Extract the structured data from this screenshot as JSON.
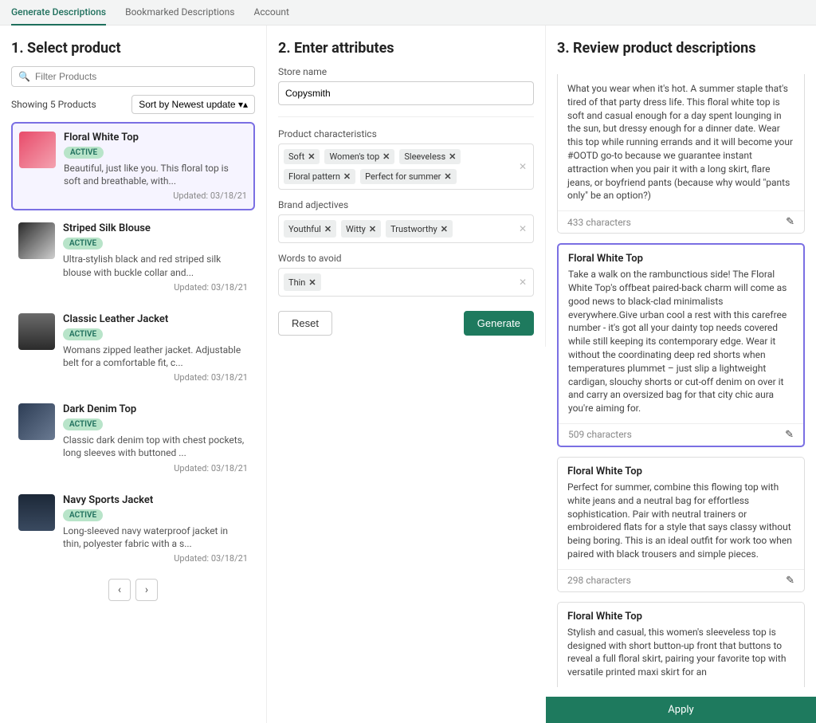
{
  "nav": {
    "tabs": [
      "Generate Descriptions",
      "Bookmarked Descriptions",
      "Account"
    ],
    "active": 0
  },
  "col1": {
    "title": "1. Select product",
    "filter_placeholder": "Filter Products",
    "showing": "Showing 5 Products",
    "sort_label": "Sort by Newest update",
    "updated_prefix": "Updated: ",
    "products": [
      {
        "name": "Floral White Top",
        "status": "ACTIVE",
        "desc": "Beautiful, just like you. This floral top is soft and breathable, with...",
        "updated": "03/18/21",
        "thumb": "th-floral",
        "selected": true
      },
      {
        "name": "Striped Silk Blouse",
        "status": "ACTIVE",
        "desc": "Ultra-stylish black and red striped silk blouse with buckle collar and...",
        "updated": "03/18/21",
        "thumb": "th-striped"
      },
      {
        "name": "Classic Leather Jacket",
        "status": "ACTIVE",
        "desc": "Womans zipped leather jacket. Adjustable belt for a comfortable fit, c...",
        "updated": "03/18/21",
        "thumb": "th-leather"
      },
      {
        "name": "Dark Denim Top",
        "status": "ACTIVE",
        "desc": "Classic dark denim top with chest pockets, long sleeves with buttoned ...",
        "updated": "03/18/21",
        "thumb": "th-denim"
      },
      {
        "name": "Navy Sports Jacket",
        "status": "ACTIVE",
        "desc": "Long-sleeved navy waterproof jacket in thin, polyester fabric with a s...",
        "updated": "03/18/21",
        "thumb": "th-navy"
      }
    ]
  },
  "col2": {
    "title": "2. Enter attributes",
    "store_label": "Store name",
    "store_value": "Copysmith",
    "pc_label": "Product characteristics",
    "pc_tags": [
      "Soft",
      "Women's top",
      "Sleeveless",
      "Floral pattern",
      "Perfect for summer"
    ],
    "ba_label": "Brand adjectives",
    "ba_tags": [
      "Youthful",
      "Witty",
      "Trustworthy"
    ],
    "wa_label": "Words to avoid",
    "wa_tags": [
      "Thin"
    ],
    "reset": "Reset",
    "generate": "Generate"
  },
  "col3": {
    "title": "3. Review product descriptions",
    "apply": "Apply",
    "cards": [
      {
        "title": "",
        "text": "What you wear when it's hot. A summer staple that's tired of that party dress life. This floral white top is soft and casual enough for a day spent lounging in the sun, but dressy enough for a dinner date. Wear this top while running errands and it will become your #OOTD go-to because we guarantee instant attraction when you pair it with a long skirt, flare jeans, or boyfriend pants (because why would \"pants only\" be an option?)",
        "chars": "433 characters",
        "top_cut": true
      },
      {
        "title": "Floral White Top",
        "text": "Take a walk on the rambunctious side! The Floral White Top's offbeat paired-back charm will come as good news to black-clad minimalists everywhere.Give urban cool a rest with this carefree number - it's got all your dainty top needs covered while still keeping its contemporary edge. Wear it without the coordinating deep red shorts when temperatures plummet – just slip a lightweight cardigan, slouchy shorts or cut-off denim on over it and carry an oversized bag for that city chic aura you're aiming for.",
        "chars": "509 characters",
        "selected": true
      },
      {
        "title": "Floral White Top",
        "text": "Perfect for summer, combine this flowing top with white jeans and a neutral bag for effortless sophistication. Pair with neutral trainers or embroidered flats for a style that says classy without being boring. This is an ideal outfit for work too when paired with black trousers and simple pieces.",
        "chars": "298 characters"
      },
      {
        "title": "Floral White Top",
        "text": "Stylish and casual, this women's sleeveless top is designed with short button-up front that buttons to reveal a full floral skirt, pairing your favorite top with versatile printed maxi skirt for an",
        "chars": "",
        "bottom_cut": true
      }
    ]
  }
}
